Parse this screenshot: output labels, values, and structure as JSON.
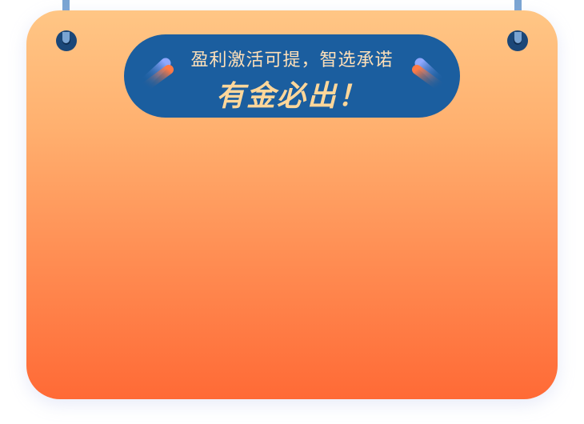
{
  "banner": {
    "subtitle": "盈利激活可提，智选承诺",
    "title": "有金必出！"
  },
  "colors": {
    "card_top": "#ffc685",
    "card_bottom": "#ff6a36",
    "banner_bg": "#1b5e9f",
    "banner_text": "#ffd79a",
    "string": "#7aa4d2",
    "hole": "#1b4778"
  },
  "icons": {
    "left_decoration": "capsule-sparkle-icon",
    "right_decoration": "capsule-sparkle-icon"
  }
}
